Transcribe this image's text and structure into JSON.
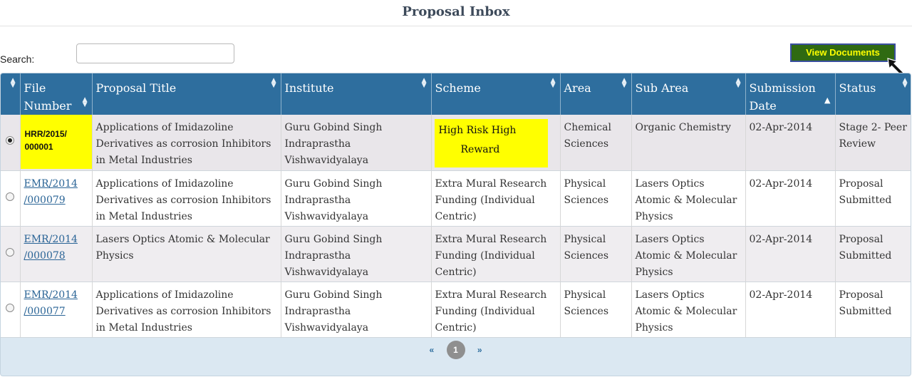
{
  "page": {
    "title": "Proposal Inbox"
  },
  "search": {
    "label": "Search:",
    "value": ""
  },
  "toolbar": {
    "view_documents_label": "View Documents"
  },
  "table": {
    "columns": [
      "File Number",
      "Proposal Title",
      "Institute",
      "Scheme",
      "Area",
      "Sub Area",
      "Submission Date",
      "Status"
    ],
    "rows": [
      {
        "selected": true,
        "file_number": "HRR/2015/\n000001",
        "title": "Applications of Imidazoline Derivatives as corrosion Inhibitors in Metal Industries",
        "institute": "Guru Gobind Singh Indraprastha Vishwavidyalaya",
        "scheme": {
          "line1": "High Risk High",
          "line2": "Reward"
        },
        "area": "Chemical Sciences",
        "sub_area": "Organic Chemistry",
        "date": "02-Apr-2014",
        "status": "Stage 2- Peer Review"
      },
      {
        "selected": false,
        "file_number": "EMR/2014\n/000079",
        "title": "Applications of Imidazoline Derivatives as corrosion Inhibitors in Metal Industries",
        "institute": "Guru Gobind Singh Indraprastha Vishwavidyalaya",
        "scheme": "Extra Mural Research Funding (Individual Centric)",
        "area": "Physical Sciences",
        "sub_area": "Lasers Optics Atomic & Molecular Physics",
        "date": "02-Apr-2014",
        "status": "Proposal Submitted"
      },
      {
        "selected": false,
        "file_number": "EMR/2014\n/000078",
        "title": "Lasers Optics Atomic & Molecular Physics",
        "institute": "Guru Gobind Singh Indraprastha Vishwavidyalaya",
        "scheme": "Extra Mural Research Funding (Individual Centric)",
        "area": "Physical Sciences",
        "sub_area": "Lasers Optics Atomic & Molecular Physics",
        "date": "02-Apr-2014",
        "status": "Proposal Submitted"
      },
      {
        "selected": false,
        "file_number": "EMR/2014\n/000077",
        "title": "Applications of Imidazoline Derivatives as corrosion Inhibitors in Metal Industries",
        "institute": "Guru Gobind Singh Indraprastha Vishwavidyalaya",
        "scheme": "Extra Mural Research Funding (Individual Centric)",
        "area": "Physical Sciences",
        "sub_area": "Lasers Optics Atomic & Molecular Physics",
        "date": "02-Apr-2014",
        "status": "Proposal Submitted"
      }
    ]
  },
  "pagination": {
    "prev": "«",
    "current": "1",
    "next": "»"
  },
  "colors": {
    "header_bg": "#2e6e9e",
    "highlight": "#ffff00",
    "button_bg": "#2f6a12",
    "button_text": "#ffff00"
  },
  "icons": {
    "sort": "sort-icon",
    "sort_active": "sort-asc-icon",
    "cursor": "mouse-pointer-icon"
  }
}
